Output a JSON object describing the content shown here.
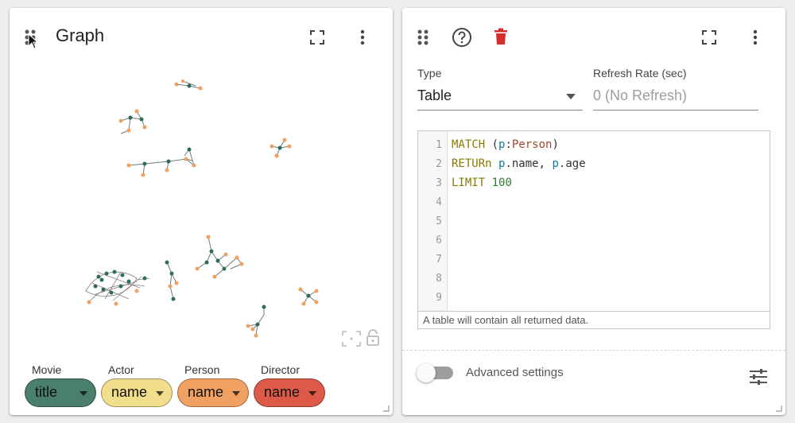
{
  "left_card": {
    "title": "Graph",
    "legend": [
      {
        "label": "Movie",
        "chip": "title",
        "color": "#4a7f6b"
      },
      {
        "label": "Actor",
        "chip": "name",
        "color": "#f0de8c"
      },
      {
        "label": "Person",
        "chip": "name",
        "color": "#f0a060"
      },
      {
        "label": "Director",
        "chip": "name",
        "color": "#dd5a48"
      }
    ],
    "icons": [
      "drag-handle-icon",
      "fullscreen-icon",
      "more-vert-icon",
      "fit-graph-icon",
      "unlock-icon",
      "resize-corner-icon"
    ]
  },
  "right_card": {
    "type_label": "Type",
    "type_value": "Table",
    "refresh_label": "Refresh Rate (sec)",
    "refresh_placeholder": "0 (No Refresh)",
    "line_numbers": [
      "1",
      "2",
      "3",
      "4",
      "5",
      "6",
      "7",
      "8",
      "9"
    ],
    "code": {
      "l1": {
        "kw": "MATCH",
        "p1": " (",
        "var": "p",
        "colon": ":",
        "label": "Person",
        "p2": ")"
      },
      "l2": {
        "kw": "RETURn",
        "sp": " ",
        "v1": "p",
        "t1": ".name, ",
        "v2": "p",
        "t2": ".age"
      },
      "l3": {
        "kw": "LIMIT",
        "sp": " ",
        "num": "100"
      }
    },
    "helper_text": "A table will contain all returned data.",
    "advanced_label": "Advanced settings",
    "accent_delete": "#d32f2f",
    "icons": [
      "drag-handle-icon",
      "help-icon",
      "delete-icon",
      "fullscreen-icon",
      "more-vert-icon",
      "tune-icon",
      "resize-corner-icon"
    ]
  }
}
